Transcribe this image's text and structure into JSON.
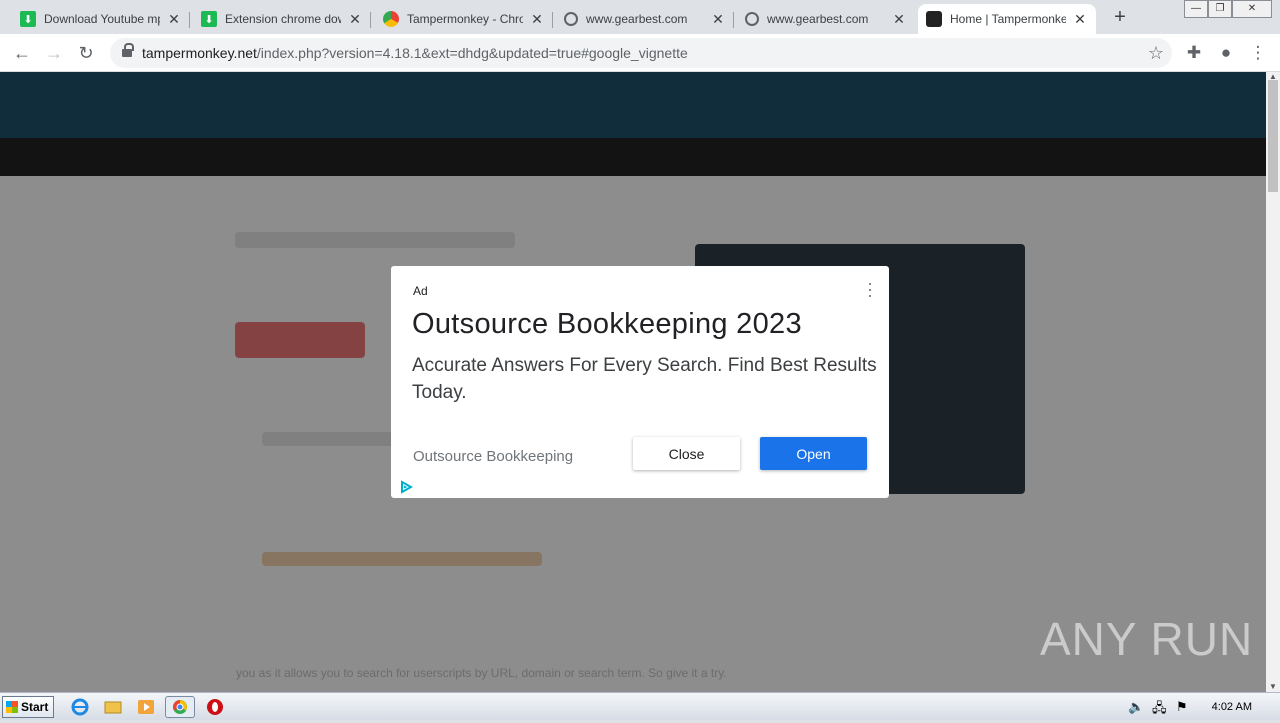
{
  "browser": {
    "tabs": [
      {
        "title": "Download Youtube mp3,",
        "icon": "download-favicon"
      },
      {
        "title": "Extension chrome downl",
        "icon": "download-favicon"
      },
      {
        "title": "Tampermonkey - Chrome",
        "icon": "chrome-webstore-favicon"
      },
      {
        "title": "www.gearbest.com",
        "icon": "globe-icon"
      },
      {
        "title": "www.gearbest.com",
        "icon": "globe-icon"
      },
      {
        "title": "Home | Tampermonkey",
        "icon": "tampermonkey-favicon",
        "active": true
      }
    ],
    "new_tab_label": "+",
    "url_host": "tampermonkey.net",
    "url_path": "/index.php?version=4.18.1&ext=dhdg&updated=true#google_vignette"
  },
  "page": {
    "bottom_text": "you as it allows you to search for userscripts by URL, domain or search term. So give it a try."
  },
  "ad": {
    "label": "Ad",
    "title": "Outsource Bookkeeping 2023",
    "description": "Accurate Answers For Every Search. Find Best Results Today.",
    "display_url": "Outsource Bookkeeping",
    "close_label": "Close",
    "open_label": "Open",
    "open_color": "#1a73e8"
  },
  "watermark": "ANY RUN",
  "taskbar": {
    "start_label": "Start",
    "clock": "4:02 AM"
  }
}
